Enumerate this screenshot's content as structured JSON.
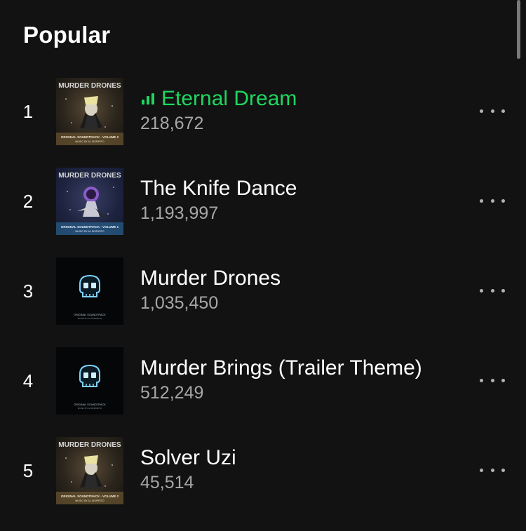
{
  "section": {
    "title": "Popular"
  },
  "tracks": [
    {
      "index": "1",
      "title": "Eternal Dream",
      "plays": "218,672",
      "playing": true,
      "cover": "murder-drones-vol2-cover",
      "cover_text": "MURDER DRONES",
      "cover_sub": "ORIGINAL SOUNDTRACK - VOLUME 2",
      "cover_credit": "MUSIC BY AJ DISPIRITO"
    },
    {
      "index": "2",
      "title": "The Knife Dance",
      "plays": "1,193,997",
      "playing": false,
      "cover": "murder-drones-vol1-cover",
      "cover_text": "MURDER DRONES",
      "cover_sub": "ORIGINAL SOUNDTRACK - VOLUME 1",
      "cover_credit": "MUSIC BY AJ DISPIRITO"
    },
    {
      "index": "3",
      "title": "Murder Drones",
      "plays": "1,035,450",
      "playing": false,
      "cover": "skull-soundtrack-cover",
      "cover_sub": "ORIGINAL SOUNDTRACK",
      "cover_credit": "MUSIC BY AJ DISPIRITO"
    },
    {
      "index": "4",
      "title": "Murder Brings (Trailer Theme)",
      "plays": "512,249",
      "playing": false,
      "cover": "skull-soundtrack-cover",
      "cover_sub": "ORIGINAL SOUNDTRACK",
      "cover_credit": "MUSIC BY AJ DISPIRITO"
    },
    {
      "index": "5",
      "title": "Solver Uzi",
      "plays": "45,514",
      "playing": false,
      "cover": "murder-drones-vol2-cover",
      "cover_text": "MURDER DRONES",
      "cover_sub": "ORIGINAL SOUNDTRACK - VOLUME 2",
      "cover_credit": "MUSIC BY AJ DISPIRITO"
    }
  ],
  "icons": {
    "now_playing": "equalizer-bars-icon",
    "more": "more-options-icon"
  },
  "colors": {
    "background": "#121212",
    "accent": "#1ed760",
    "secondary_text": "#a7a7a7"
  }
}
